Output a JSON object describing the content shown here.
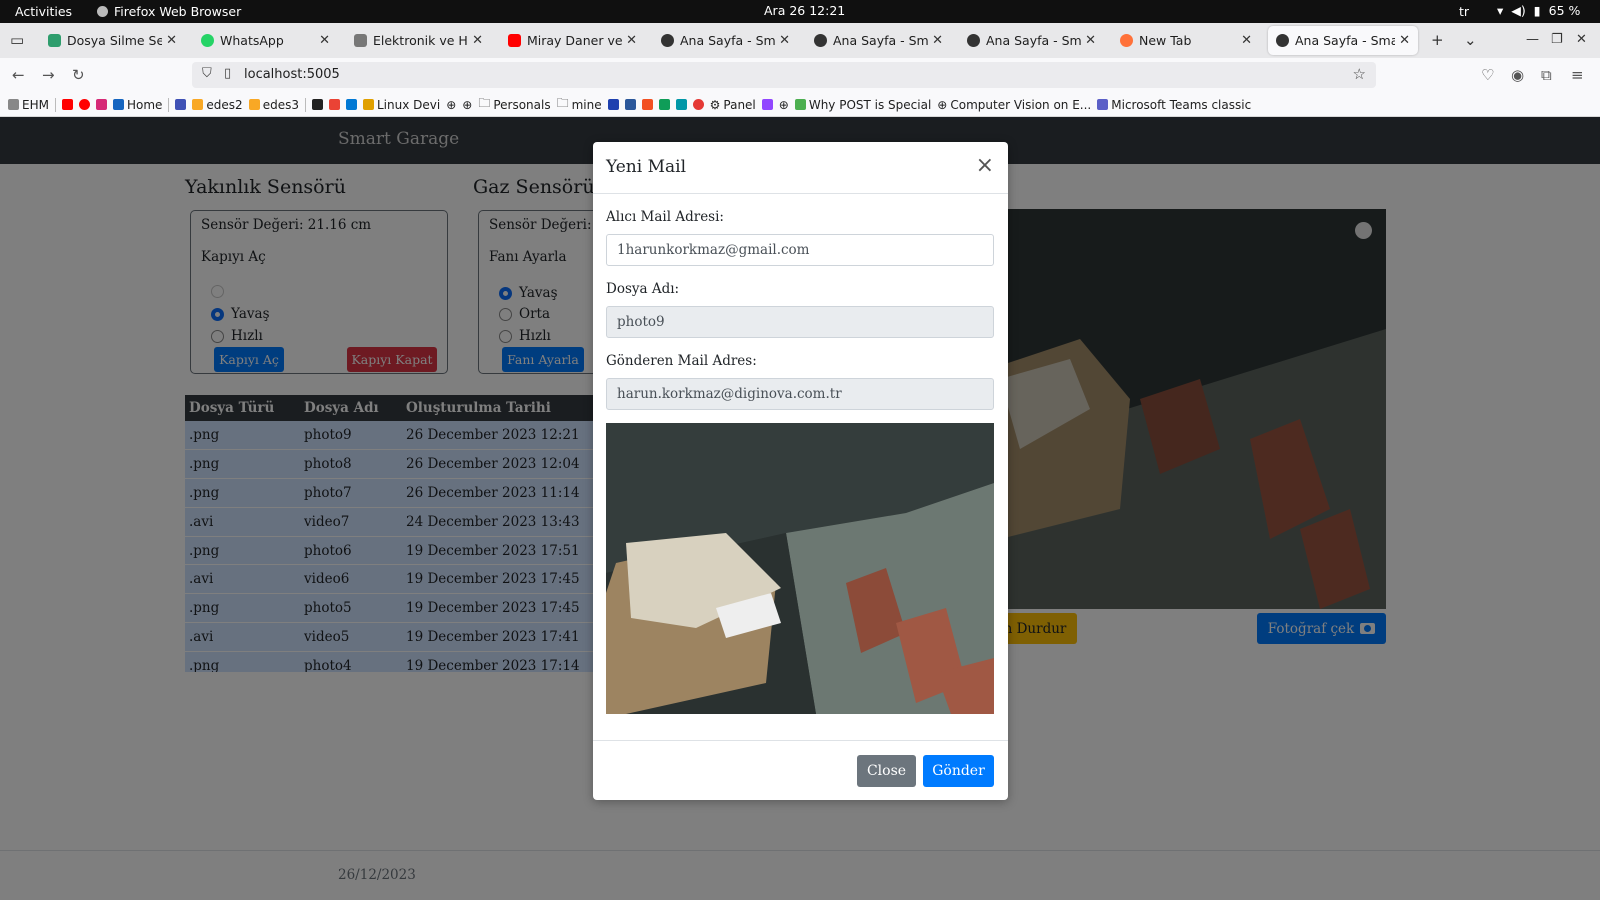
{
  "topbar": {
    "activities": "Activities",
    "app": "Firefox Web Browser",
    "clock": "Ara 26  12:21",
    "lang": "tr",
    "battery": "65 %"
  },
  "tabs": [
    {
      "title": "Dosya Silme Servisi",
      "color": "#2e9d6d"
    },
    {
      "title": "WhatsApp",
      "color": "#25d366"
    },
    {
      "title": "Elektronik ve Haber",
      "color": "#777777"
    },
    {
      "title": "Miray Daner ve Birce",
      "color": "#ff0000"
    },
    {
      "title": "Ana Sayfa - Smart G",
      "color": "#333333"
    },
    {
      "title": "Ana Sayfa - Smart G",
      "color": "#333333"
    },
    {
      "title": "Ana Sayfa - Smart G",
      "color": "#333333"
    },
    {
      "title": "New Tab",
      "color": "#ff7139"
    },
    {
      "title": "Ana Sayfa - Smart G",
      "color": "#333333"
    }
  ],
  "url": "localhost:5005",
  "bookmarks": {
    "ehm": "EHM",
    "home": "Home",
    "edes2": "edes2",
    "edes3": "edes3",
    "linux": "Linux Devi",
    "personals": "Personals",
    "mine": "mine",
    "panel": "Panel",
    "whypost": "Why POST is Special",
    "cv": "Computer Vision on E...",
    "teams": "Microsoft Teams classic"
  },
  "site": {
    "brand": "Smart Garage",
    "proximity": {
      "title": "Yakınlık Sensörü",
      "value": "Sensör Değeri: 21.16 cm",
      "label": "Kapıyı Aç",
      "options": [
        "",
        "Yavaş",
        "Hızlı"
      ],
      "open_btn": "Kapıyı Aç",
      "close_btn": "Kapıyı Kapat"
    },
    "gas": {
      "title": "Gaz Sensörü",
      "value": "Sensör Değeri:",
      "label": "Fanı Ayarla",
      "options": [
        "Yavaş",
        "Orta",
        "Hızlı"
      ],
      "btn": "Fanı Ayarla"
    },
    "files": {
      "headers": [
        "Dosya Türü",
        "Dosya Adı",
        "Oluşturulma Tarihi"
      ],
      "rows": [
        [
          ".png",
          "photo9",
          "26 December 2023 12:21"
        ],
        [
          ".png",
          "photo8",
          "26 December 2023 12:04"
        ],
        [
          ".png",
          "photo7",
          "26 December 2023 11:14"
        ],
        [
          ".avi",
          "video7",
          "24 December 2023 13:43"
        ],
        [
          ".png",
          "photo6",
          "19 December 2023 17:51"
        ],
        [
          ".avi",
          "video6",
          "19 December 2023 17:45"
        ],
        [
          ".png",
          "photo5",
          "19 December 2023 17:45"
        ],
        [
          ".avi",
          "video5",
          "19 December 2023 17:41"
        ],
        [
          ".png",
          "photo4",
          "19 December 2023 17:14"
        ]
      ]
    },
    "stop_btn": "n Durdur",
    "photo_btn": "Fotoğraf çek",
    "footer_date": "26/12/2023"
  },
  "modal": {
    "title": "Yeni Mail",
    "recipient_label": "Alıcı Mail Adresi:",
    "recipient_value": "1harunkorkmaz@gmail.com",
    "filename_label": "Dosya Adı:",
    "filename_value": "photo9",
    "sender_label": "Gönderen Mail Adres:",
    "sender_value": "harun.korkmaz@diginova.com.tr",
    "close_btn": "Close",
    "send_btn": "Gönder"
  }
}
